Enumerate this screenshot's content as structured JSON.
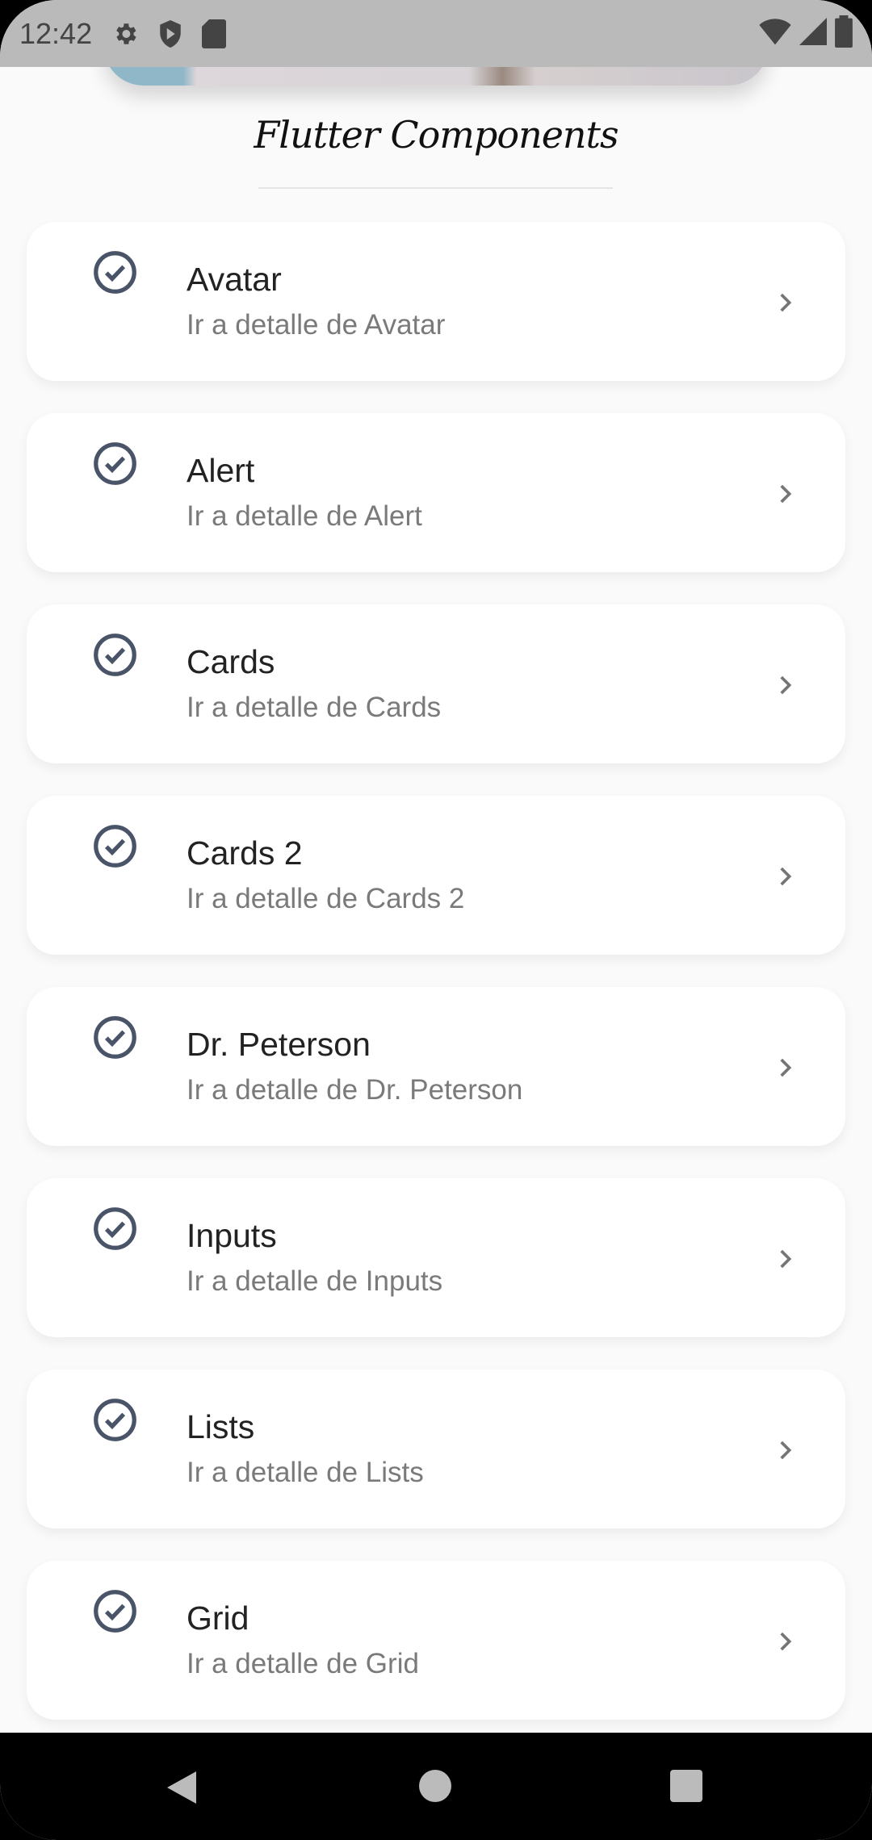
{
  "status_bar": {
    "time": "12:42",
    "icons": [
      "gear-icon",
      "shield-play-icon",
      "sd-card-icon",
      "wifi-icon",
      "signal-icon",
      "battery-icon"
    ]
  },
  "header": {
    "title": "Flutter Components"
  },
  "items": [
    {
      "title": "Avatar",
      "subtitle": "Ir a detalle de Avatar"
    },
    {
      "title": "Alert",
      "subtitle": "Ir a detalle de Alert"
    },
    {
      "title": "Cards",
      "subtitle": "Ir a detalle de Cards"
    },
    {
      "title": "Cards 2",
      "subtitle": "Ir a detalle de Cards 2"
    },
    {
      "title": "Dr. Peterson",
      "subtitle": "Ir a detalle de Dr. Peterson"
    },
    {
      "title": "Inputs",
      "subtitle": "Ir a detalle de Inputs"
    },
    {
      "title": "Lists",
      "subtitle": "Ir a detalle de Lists"
    },
    {
      "title": "Grid",
      "subtitle": "Ir a detalle de Grid"
    }
  ],
  "colors": {
    "icon": "#4a5468",
    "chevron": "#757575",
    "status_bg": "#bababa"
  }
}
